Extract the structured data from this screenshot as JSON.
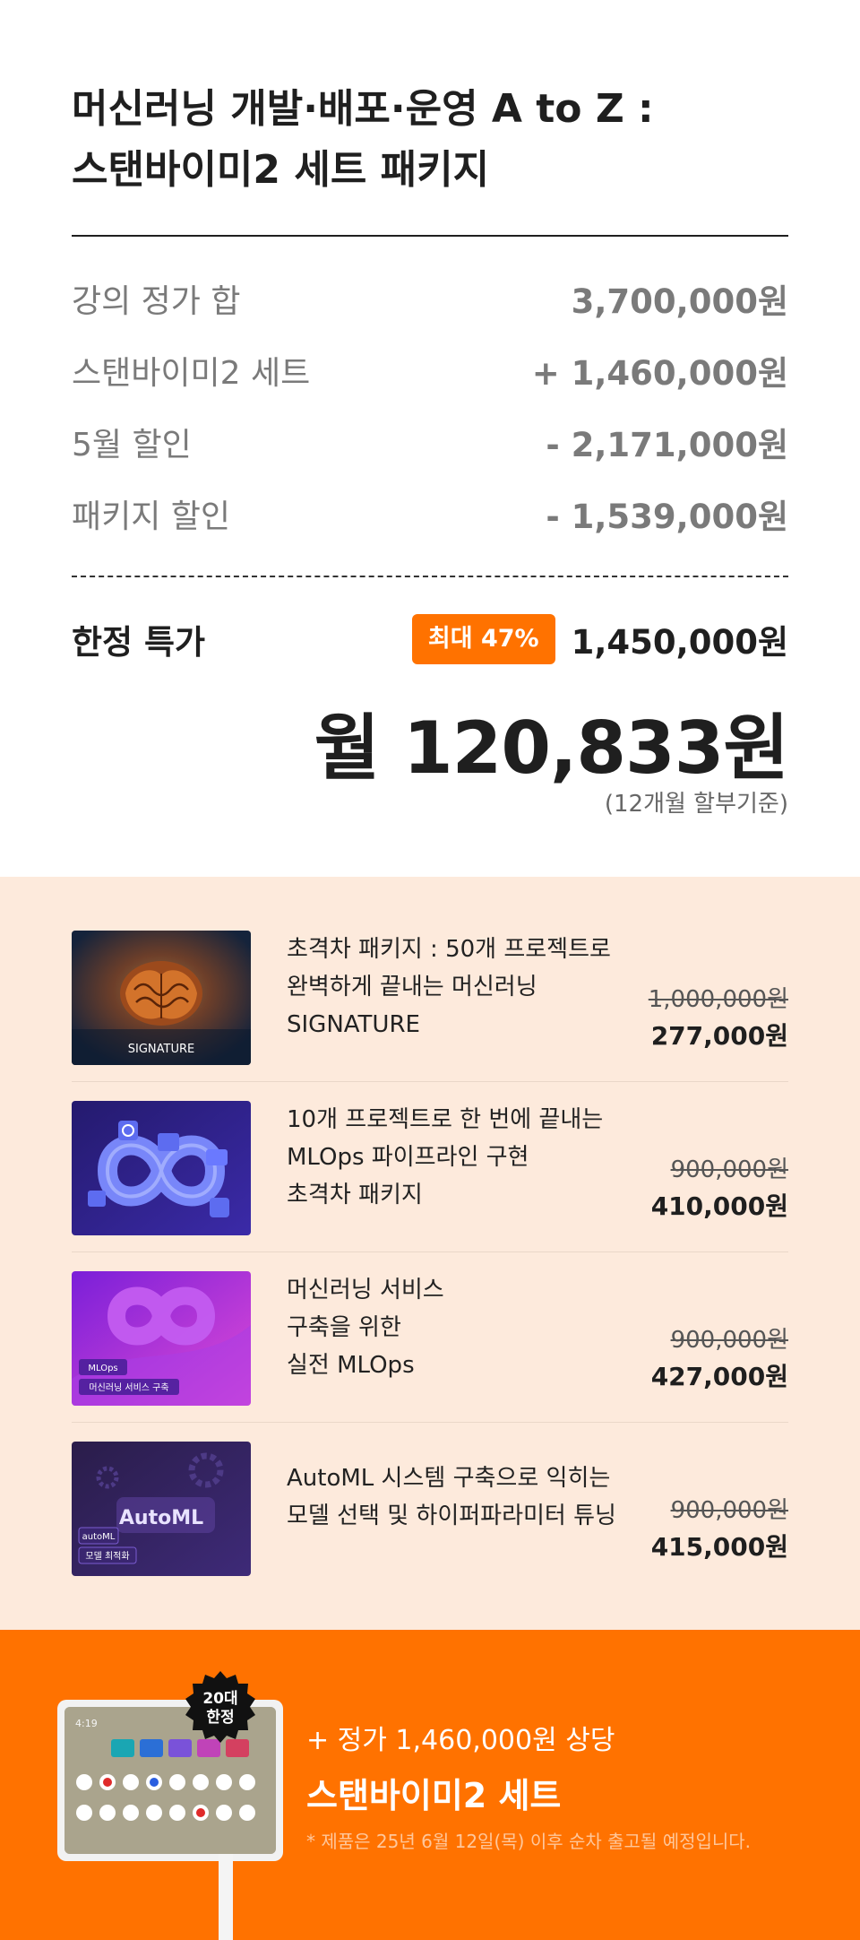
{
  "header": {
    "title_line1": "머신러닝 개발·배포·운영 A to Z :",
    "title_line2": "스탠바이미2 세트 패키지"
  },
  "pricing": {
    "rows": [
      {
        "label": "강의 정가 합",
        "value": "3,700,000원"
      },
      {
        "label": "스탠바이미2 세트",
        "value": "+ 1,460,000원"
      },
      {
        "label": "5월 할인",
        "value": "- 2,171,000원"
      },
      {
        "label": "패키지 할인",
        "value": "- 1,539,000원"
      }
    ],
    "special_label": "한정 특가",
    "badge": "최대 47%",
    "special_price": "1,450,000원",
    "monthly": "월 120,833원",
    "monthly_note": "(12개월 할부기준)"
  },
  "courses": [
    {
      "lines": [
        "초격차 패키지 : 50개 프로젝트로",
        "완벽하게 끝내는 머신러닝",
        "SIGNATURE"
      ],
      "original": "1,000,000원",
      "sale": "277,000원",
      "thumb_caption": "SIGNATURE",
      "thumb_colors": [
        "#1b2a44",
        "#e07a2a"
      ]
    },
    {
      "lines": [
        "10개 프로젝트로 한 번에 끝내는",
        "MLOps 파이프라인 구현",
        "초격차 패키지"
      ],
      "original": "900,000원",
      "sale": "410,000원",
      "thumb_colors": [
        "#2a1f7a",
        "#6b7cff"
      ]
    },
    {
      "lines": [
        "머신러닝 서비스",
        "구축을 위한",
        "실전 MLOps"
      ],
      "original": "900,000원",
      "sale": "427,000원",
      "thumb_tag1": "MLOps",
      "thumb_tag2": "머신러닝 서비스 구축",
      "thumb_colors": [
        "#8a2be2",
        "#d43bd8"
      ]
    },
    {
      "lines": [
        "AutoML 시스템 구축으로 익히는",
        "모델 선택 및 하이퍼파라미터 튜닝"
      ],
      "original": "900,000원",
      "sale": "415,000원",
      "thumb_title": "AutoML",
      "thumb_tag1": "autoML",
      "thumb_tag2": "모델 최적화",
      "thumb_colors": [
        "#2a1e4a",
        "#5a3a9a"
      ]
    }
  ],
  "promo": {
    "seal_line1": "20대",
    "seal_line2": "한정",
    "line1": "+ 정가 1,460,000원 상당",
    "line2": "스탠바이미2 세트",
    "line3": "* 제품은 25년 6월 12일(목) 이후 순차 출고될 예정입니다.",
    "device_time": "4:19",
    "accent": "#ff7200"
  }
}
